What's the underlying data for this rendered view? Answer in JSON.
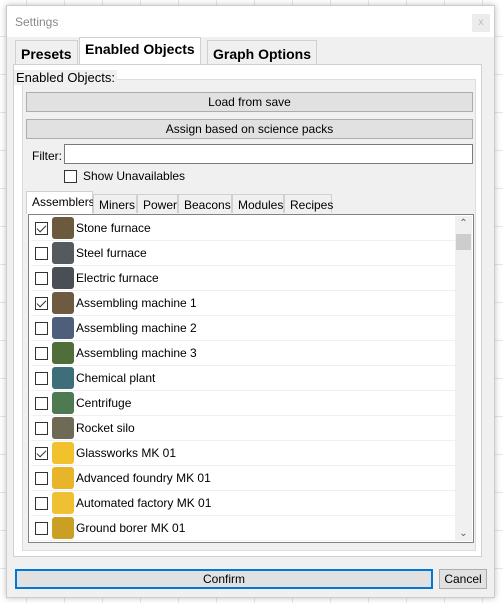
{
  "window": {
    "title": "Settings",
    "close": "x"
  },
  "tabs": [
    {
      "label": "Presets"
    },
    {
      "label": "Enabled Objects",
      "active": true
    },
    {
      "label": "Graph Options"
    }
  ],
  "group_label": "Enabled Objects:",
  "buttons": {
    "load": "Load from save",
    "assign": "Assign based on science packs",
    "confirm": "Confirm",
    "cancel": "Cancel"
  },
  "filter": {
    "label": "Filter:",
    "value": ""
  },
  "show_unavailables": {
    "label": "Show Unavailables",
    "checked": false
  },
  "subtabs": [
    {
      "label": "Assemblers",
      "active": true
    },
    {
      "label": "Miners"
    },
    {
      "label": "Power"
    },
    {
      "label": "Beacons"
    },
    {
      "label": "Modules"
    },
    {
      "label": "Recipes"
    }
  ],
  "items": [
    {
      "label": "Stone furnace",
      "checked": true,
      "color": "#6b5a3e"
    },
    {
      "label": "Steel furnace",
      "checked": false,
      "color": "#555a5e"
    },
    {
      "label": "Electric furnace",
      "checked": false,
      "color": "#4a4f55"
    },
    {
      "label": "Assembling machine 1",
      "checked": true,
      "color": "#6e5a40"
    },
    {
      "label": "Assembling machine 2",
      "checked": false,
      "color": "#4d5f7a"
    },
    {
      "label": "Assembling machine 3",
      "checked": false,
      "color": "#4f6e3a"
    },
    {
      "label": "Chemical plant",
      "checked": false,
      "color": "#3d6e7a"
    },
    {
      "label": "Centrifuge",
      "checked": false,
      "color": "#4e7a52"
    },
    {
      "label": "Rocket silo",
      "checked": false,
      "color": "#6e6a55"
    },
    {
      "label": "Glassworks MK 01",
      "checked": true,
      "color": "#f2c12e"
    },
    {
      "label": "Advanced foundry MK 01",
      "checked": false,
      "color": "#e8b52a"
    },
    {
      "label": "Automated factory MK 01",
      "checked": false,
      "color": "#efc032"
    },
    {
      "label": "Ground borer MK 01",
      "checked": false,
      "color": "#c9a024"
    }
  ]
}
